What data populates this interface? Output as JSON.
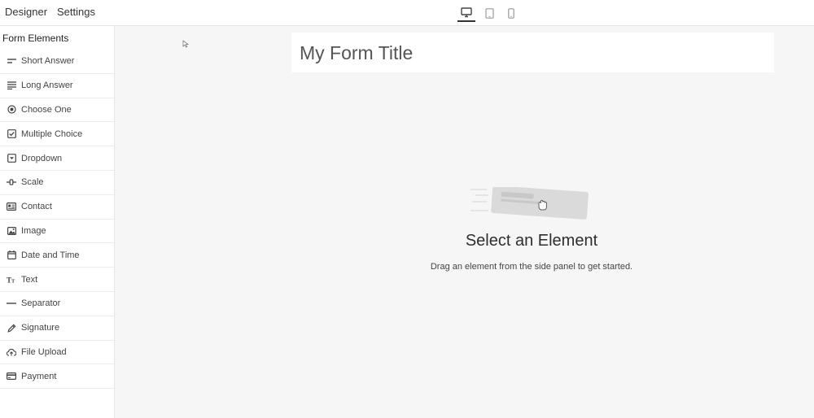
{
  "topbar": {
    "tabs": [
      {
        "label": "Designer"
      },
      {
        "label": "Settings"
      }
    ],
    "devices": [
      "desktop-icon",
      "tablet-icon",
      "mobile-icon"
    ],
    "active_device": "desktop"
  },
  "sidebar": {
    "title": "Form Elements",
    "items": [
      {
        "label": "Short Answer",
        "icon": "short-answer-icon"
      },
      {
        "label": "Long Answer",
        "icon": "long-answer-icon"
      },
      {
        "label": "Choose One",
        "icon": "radio-icon"
      },
      {
        "label": "Multiple Choice",
        "icon": "checkbox-icon"
      },
      {
        "label": "Dropdown",
        "icon": "dropdown-icon"
      },
      {
        "label": "Scale",
        "icon": "scale-icon"
      },
      {
        "label": "Contact",
        "icon": "contact-card-icon"
      },
      {
        "label": "Image",
        "icon": "image-icon"
      },
      {
        "label": "Date and Time",
        "icon": "calendar-icon"
      },
      {
        "label": "Text",
        "icon": "text-icon"
      },
      {
        "label": "Separator",
        "icon": "separator-icon"
      },
      {
        "label": "Signature",
        "icon": "pen-icon"
      },
      {
        "label": "File Upload",
        "icon": "upload-icon"
      },
      {
        "label": "Payment",
        "icon": "credit-card-icon"
      }
    ]
  },
  "canvas": {
    "form_title": "My Form Title",
    "empty_heading": "Select an Element",
    "empty_sub": "Drag an element from the side panel to get started."
  },
  "colors": {
    "canvas_bg": "#f6f6f7",
    "border": "#e6e6e6",
    "text": "#333333"
  }
}
